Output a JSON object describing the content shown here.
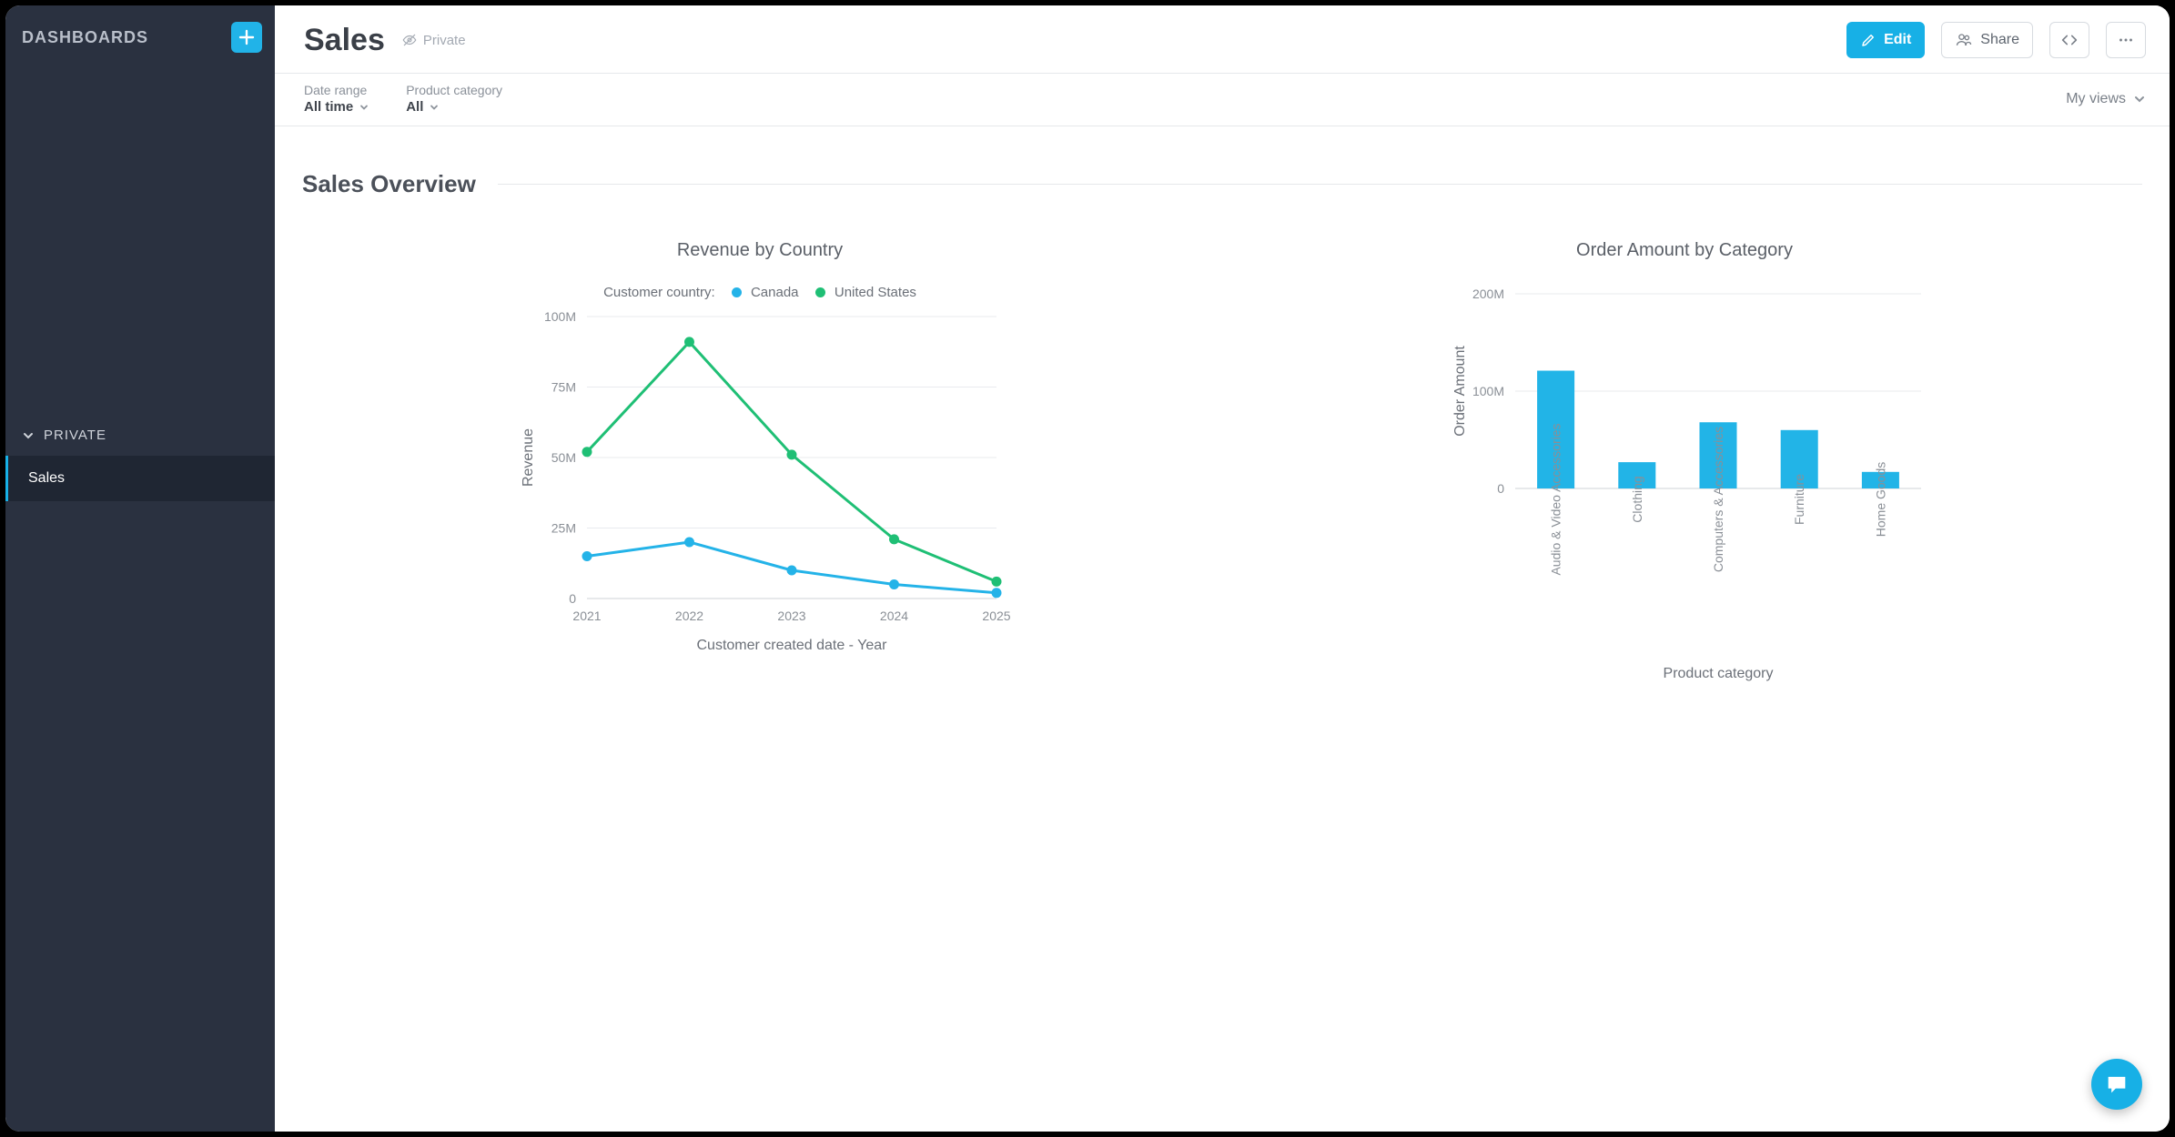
{
  "sidebar": {
    "heading": "DASHBOARDS",
    "section_label": "PRIVATE",
    "items": [
      {
        "label": "Sales",
        "active": true
      }
    ]
  },
  "page": {
    "title": "Sales",
    "visibility": "Private"
  },
  "toolbar": {
    "edit": "Edit",
    "share": "Share"
  },
  "filters": [
    {
      "label": "Date range",
      "value": "All time"
    },
    {
      "label": "Product category",
      "value": "All"
    }
  ],
  "views_label": "My views",
  "section_title": "Sales Overview",
  "colors": {
    "canada": "#24b3e8",
    "us": "#1fbf75",
    "bar": "#22b4e7"
  },
  "chart_data": [
    {
      "id": "revenue_by_country",
      "type": "line",
      "title": "Revenue by Country",
      "legend_title": "Customer country:",
      "xlabel": "Customer created date - Year",
      "ylabel": "Revenue",
      "categories": [
        "2021",
        "2022",
        "2023",
        "2024",
        "2025"
      ],
      "ylim": [
        0,
        100
      ],
      "yticks": [
        0,
        25,
        50,
        75,
        100
      ],
      "ytick_suffix": "M",
      "series": [
        {
          "name": "Canada",
          "color_key": "canada",
          "values": [
            15,
            20,
            10,
            5,
            2
          ]
        },
        {
          "name": "United States",
          "color_key": "us",
          "values": [
            52,
            91,
            51,
            21,
            6
          ]
        }
      ]
    },
    {
      "id": "order_amount_by_category",
      "type": "bar",
      "title": "Order Amount by Category",
      "xlabel": "Product category",
      "ylabel": "Order Amount",
      "categories": [
        "Audio & Video Accessories",
        "Clothing",
        "Computers & Accessories",
        "Furniture",
        "Home Goods"
      ],
      "values": [
        121,
        27,
        68,
        60,
        17
      ],
      "ylim": [
        0,
        200
      ],
      "yticks": [
        0,
        100,
        200
      ],
      "ytick_suffix": "M"
    }
  ]
}
